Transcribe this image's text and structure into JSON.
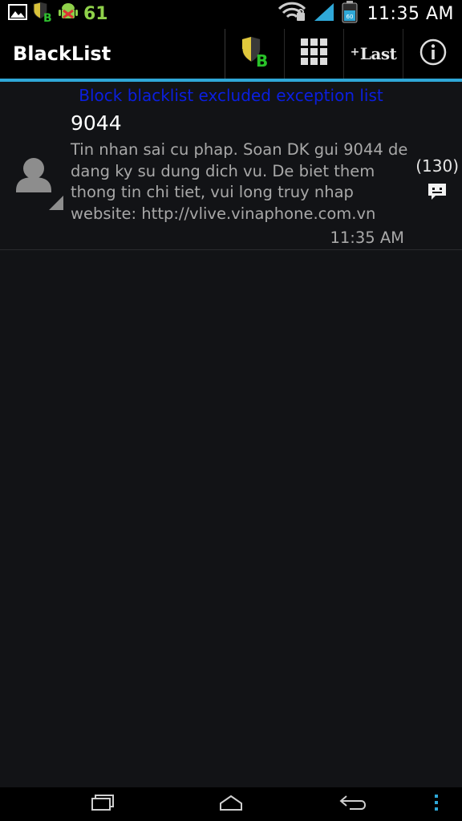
{
  "statusbar": {
    "left_icons": [
      "gallery-icon",
      "blacklist-app-icon",
      "android-debug-icon"
    ],
    "notification_count": "61",
    "right_icons": [
      "wifi-icon",
      "signal-icon",
      "battery-icon"
    ],
    "battery_level": "60",
    "time": "11:35 AM"
  },
  "actionbar": {
    "title": "BlackList",
    "actions": [
      {
        "name": "blacklist-shield-icon"
      },
      {
        "name": "grid-menu-icon"
      },
      {
        "name": "add-last-button",
        "label": "Last",
        "prefix": "+"
      },
      {
        "name": "info-icon"
      }
    ]
  },
  "notice": "Block blacklist excluded exception list",
  "messages": [
    {
      "sender": "9044",
      "body": "Tin nhan sai cu phap. Soan DK gui 9044 de dang ky su dung dich vu. De biet them thong tin chi tiet, vui long truy nhap website: http://vlive.vinaphone.com.vn",
      "time": "11:35 AM",
      "count": "(130)"
    }
  ],
  "colors": {
    "accent": "#2fa8d8",
    "notice": "#0b1fe0",
    "background": "#121316",
    "status_green": "#8fd14a"
  }
}
